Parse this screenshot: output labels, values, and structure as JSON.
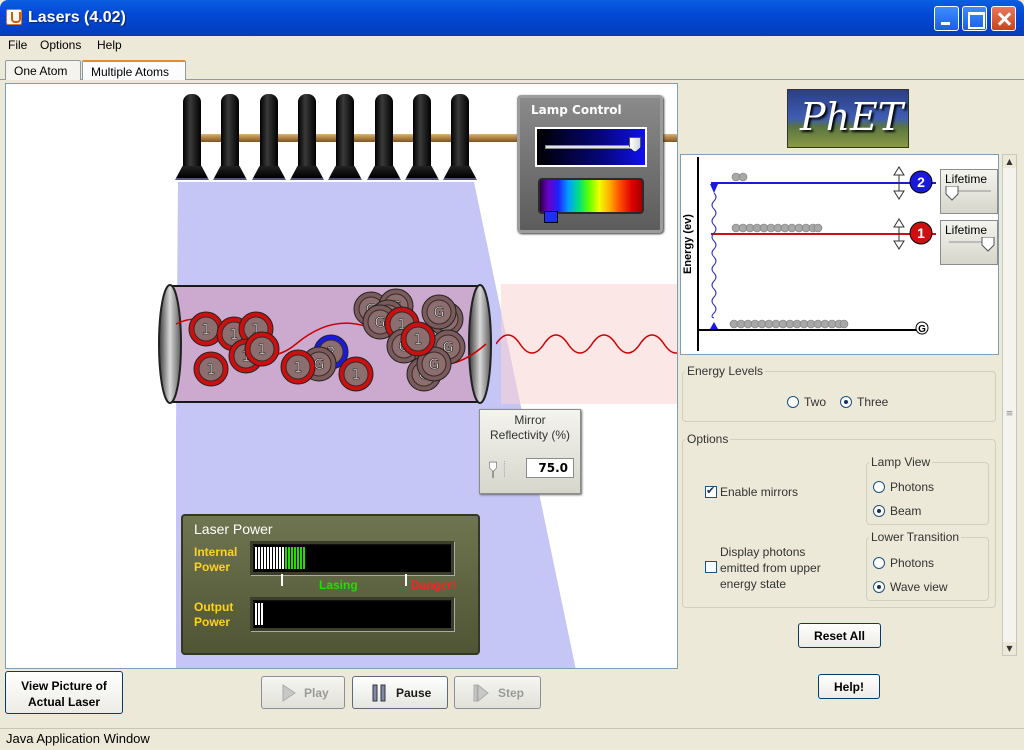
{
  "window": {
    "title": "Lasers (4.02)"
  },
  "menu": {
    "file": "File",
    "options": "Options",
    "help": "Help"
  },
  "tabs": {
    "one_atom": "One Atom",
    "multiple_atoms": "Multiple Atoms"
  },
  "lamp_control": {
    "title": "Lamp Control",
    "intensity_level": 0.96,
    "wavelength_position": 0.12
  },
  "mirror": {
    "title_line1": "Mirror",
    "title_line2": "Reflectivity (%)",
    "value": "75.0"
  },
  "laser_power": {
    "title": "Laser Power",
    "internal_label_1": "Internal",
    "internal_label_2": "Power",
    "output_label_1": "Output",
    "output_label_2": "Power",
    "lasing": "Lasing",
    "danger": "Danger!",
    "internal_white_bars": 10,
    "internal_green_bars": 7,
    "output_white_bars": 3
  },
  "atom_labels": {
    "ground": "G",
    "level1": "1",
    "level2": "2"
  },
  "energy": {
    "axis_label": "Energy (ev)",
    "lifetime_label": "Lifetime",
    "level2_badge": "2",
    "level1_badge": "1",
    "ground_badge": "G"
  },
  "energy_levels": {
    "title": "Energy Levels",
    "two": "Two",
    "three": "Three",
    "selected": "three"
  },
  "options": {
    "title": "Options",
    "enable_mirrors": "Enable mirrors",
    "display_photons_1": "Display photons",
    "display_photons_2": "emitted from upper",
    "display_photons_3": "energy state",
    "lamp_view": "Lamp View",
    "lamp_photons": "Photons",
    "lamp_beam": "Beam",
    "lower_transition": "Lower Transition",
    "lower_photons": "Photons",
    "lower_wave": "Wave view"
  },
  "buttons": {
    "view_picture_1": "View Picture of",
    "view_picture_2": "Actual Laser",
    "play": "Play",
    "pause": "Pause",
    "step": "Step",
    "reset_all": "Reset All",
    "help": "Help!"
  },
  "logo": {
    "text": "PhET"
  },
  "status": {
    "text": "Java Application Window"
  },
  "colors": {
    "level2": "#1a1adc",
    "level1": "#cc1010",
    "atom_brown": "#7a5a5a",
    "lasing_green": "#22dd00",
    "danger_red": "#ff2020",
    "label_yellow": "#ffd31a"
  }
}
